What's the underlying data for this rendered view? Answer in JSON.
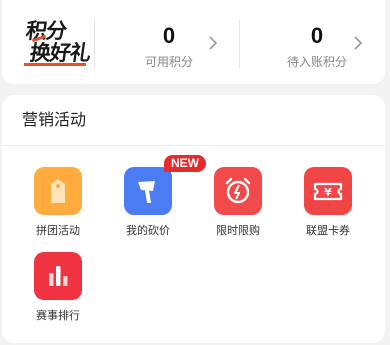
{
  "points": {
    "logo_line1": "积分",
    "logo_line2": "换好礼",
    "available": {
      "value": "0",
      "label": "可用积分"
    },
    "pending": {
      "value": "0",
      "label": "待入账积分"
    }
  },
  "marketing": {
    "title": "营销活动",
    "items": [
      {
        "label": "拼团活动",
        "icon": "tag-icon",
        "color": "#ffab3d"
      },
      {
        "label": "我的砍价",
        "icon": "axe-icon",
        "color": "#4b7cf3",
        "badge": "NEW"
      },
      {
        "label": "限时限购",
        "icon": "alarm-clock-icon",
        "color": "#f2494a"
      },
      {
        "label": "联盟卡券",
        "icon": "coupon-icon",
        "color": "#f24545"
      },
      {
        "label": "赛事排行",
        "icon": "ranking-bars-icon",
        "color": "#ef3340"
      }
    ]
  },
  "colors": {
    "accent": "#e8502e",
    "badge": "#e52b2b"
  }
}
